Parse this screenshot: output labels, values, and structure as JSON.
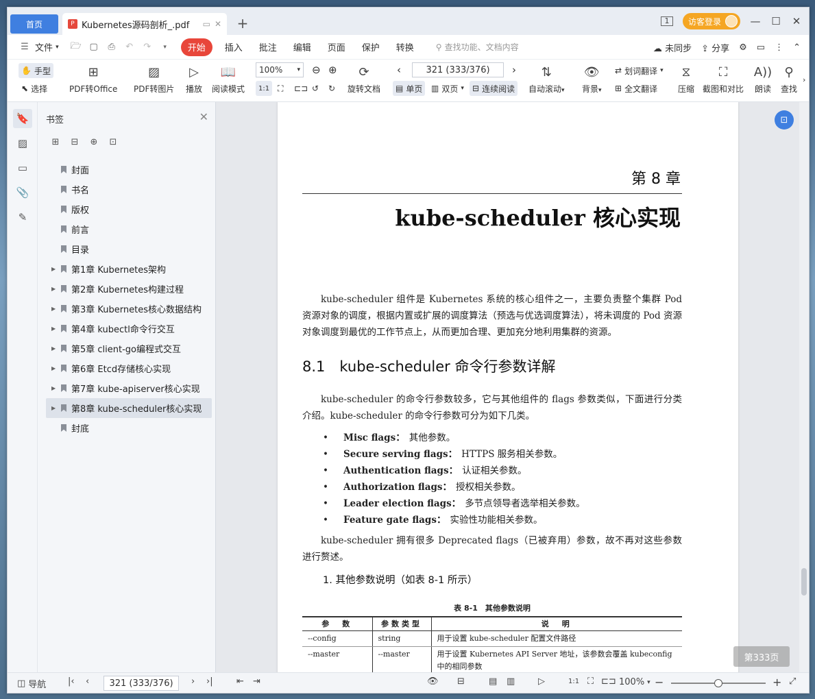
{
  "tabs": {
    "home": "首页",
    "doc_title": "Kubernetes源码剖析_.pdf",
    "new_tab": "+"
  },
  "titlebar": {
    "page_badge": "1",
    "login": "访客登录"
  },
  "menu": {
    "file": "文件",
    "items": [
      "开始",
      "插入",
      "批注",
      "编辑",
      "页面",
      "保护",
      "转换"
    ],
    "search_placeholder": "查找功能、文档内容",
    "sync": "未同步",
    "share": "分享"
  },
  "toolbar": {
    "hand": "手型",
    "select": "选择",
    "pdf_to_office": "PDF转Office",
    "pdf_to_image": "PDF转图片",
    "play": "播放",
    "read_mode": "阅读模式",
    "zoom": "100%",
    "rotate_doc": "旋转文档",
    "page_input": "321 (333/376)",
    "single": "单页",
    "double": "双页",
    "continuous": "连续阅读",
    "auto_scroll": "自动滚动",
    "background": "背景",
    "word_translate": "划词翻译",
    "full_translate": "全文翻译",
    "compress": "压缩",
    "screenshot_compare": "截图和对比",
    "read_aloud": "朗读",
    "find": "查找"
  },
  "bookmarks": {
    "title": "书签",
    "items": [
      {
        "label": "封面",
        "expandable": false
      },
      {
        "label": "书名",
        "expandable": false
      },
      {
        "label": "版权",
        "expandable": false
      },
      {
        "label": "前言",
        "expandable": false
      },
      {
        "label": "目录",
        "expandable": false
      },
      {
        "label": "第1章 Kubernetes架构",
        "expandable": true
      },
      {
        "label": "第2章 Kubernetes构建过程",
        "expandable": true
      },
      {
        "label": "第3章 Kubernetes核心数据结构",
        "expandable": true
      },
      {
        "label": "第4章 kubectl命令行交互",
        "expandable": true
      },
      {
        "label": "第5章 client-go编程式交互",
        "expandable": true
      },
      {
        "label": "第6章 Etcd存储核心实现",
        "expandable": true
      },
      {
        "label": "第7章 kube-apiserver核心实现",
        "expandable": true
      },
      {
        "label": "第8章 kube-scheduler核心实现",
        "expandable": true,
        "selected": true
      },
      {
        "label": "封底",
        "expandable": false
      }
    ]
  },
  "document": {
    "chapter_num": "第 8 章",
    "chapter_title": "kube-scheduler 核心实现",
    "para1": "kube-scheduler 组件是 Kubernetes 系统的核心组件之一，主要负责整个集群 Pod 资源对象的调度，根据内置或扩展的调度算法（预选与优选调度算法），将未调度的 Pod 资源对象调度到最优的工作节点上，从而更加合理、更加充分地利用集群的资源。",
    "section_title": "8.1　kube-scheduler 命令行参数详解",
    "para2": "kube-scheduler 的命令行参数较多，它与其他组件的 flags 参数类似，下面进行分类介绍。kube-scheduler 的命令行参数可分为如下几类。",
    "bullets": [
      {
        "bold": "Misc flags：",
        "text": "其他参数。"
      },
      {
        "bold": "Secure serving flags：",
        "text": "HTTPS 服务相关参数。"
      },
      {
        "bold": "Authentication flags：",
        "text": "认证相关参数。"
      },
      {
        "bold": "Authorization flags：",
        "text": "授权相关参数。"
      },
      {
        "bold": "Leader election flags：",
        "text": "多节点领导者选举相关参数。"
      },
      {
        "bold": "Feature gate flags：",
        "text": "实验性功能相关参数。"
      }
    ],
    "para3": "kube-scheduler 拥有很多 Deprecated flags（已被弃用）参数，故不再对这些参数进行赘述。",
    "subsection": "1. 其他参数说明（如表 8-1 所示）",
    "table_caption": "表 8-1　其他参数说明",
    "table_headers": [
      "参　数",
      "参数类型",
      "说　明"
    ],
    "table_rows": [
      [
        "--config",
        "string",
        "用于设置 kube-scheduler 配置文件路径"
      ],
      [
        "--master",
        "--master",
        "用于设置 Kubernetes API Server 地址，该参数会覆盖 kubeconfig 中的相同参数"
      ]
    ],
    "page_tip": "第333页"
  },
  "statusbar": {
    "nav": "导航",
    "page_input": "321 (333/376)",
    "zoom": "100%"
  }
}
